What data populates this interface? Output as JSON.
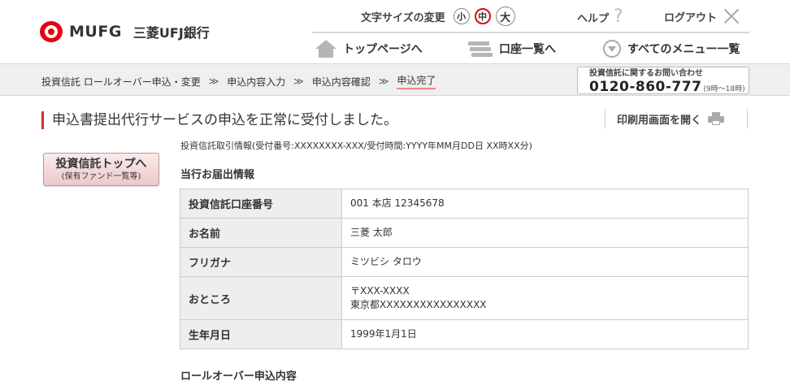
{
  "header": {
    "logo_text": "MUFG",
    "bank_name": "三菱UFJ銀行",
    "font_size_label": "文字サイズの変更",
    "font_sizes": [
      "小",
      "中",
      "大"
    ],
    "help_label": "ヘルプ",
    "logout_label": "ログアウト"
  },
  "gnav": {
    "top_label": "トップページへ",
    "accounts_label": "口座一覧へ",
    "menu_label": "すべてのメニュー一覧"
  },
  "breadcrumb": {
    "items": [
      "投資信託 ロールオーバー申込・変更",
      "申込内容入力",
      "申込内容確認",
      "申込完了"
    ],
    "separator": "≫"
  },
  "contact": {
    "label": "投資信託に関するお問い合わせ",
    "tel": "0120-860-777",
    "hours": "(9時〜18時)"
  },
  "page": {
    "title": "申込書提出代行サービスの申込を正常に受付しました。",
    "print_label": "印刷用画面を開く"
  },
  "side_button": {
    "main": "投資信託トップへ",
    "sub": "(保有ファンド一覧等)"
  },
  "receipt_text": "投資信託取引情報(受付番号:XXXXXXXX-XXX/受付時間:YYYY年MM月DD日 XX時XX分)",
  "section1_title": "当行お届出情報",
  "section2_title": "ロールオーバー申込内容",
  "info_rows": [
    {
      "label": "投資信託口座番号",
      "value": [
        "001 本店 12345678"
      ]
    },
    {
      "label": "お名前",
      "value": [
        "三菱 太郎"
      ]
    },
    {
      "label": "フリガナ",
      "value": [
        "ミツビシ タロウ"
      ]
    },
    {
      "label": "おところ",
      "value": [
        "〒XXX-XXXX",
        "東京都XXXXXXXXXXXXXXXX"
      ]
    },
    {
      "label": "生年月日",
      "value": [
        "1999年1月1日"
      ]
    }
  ]
}
